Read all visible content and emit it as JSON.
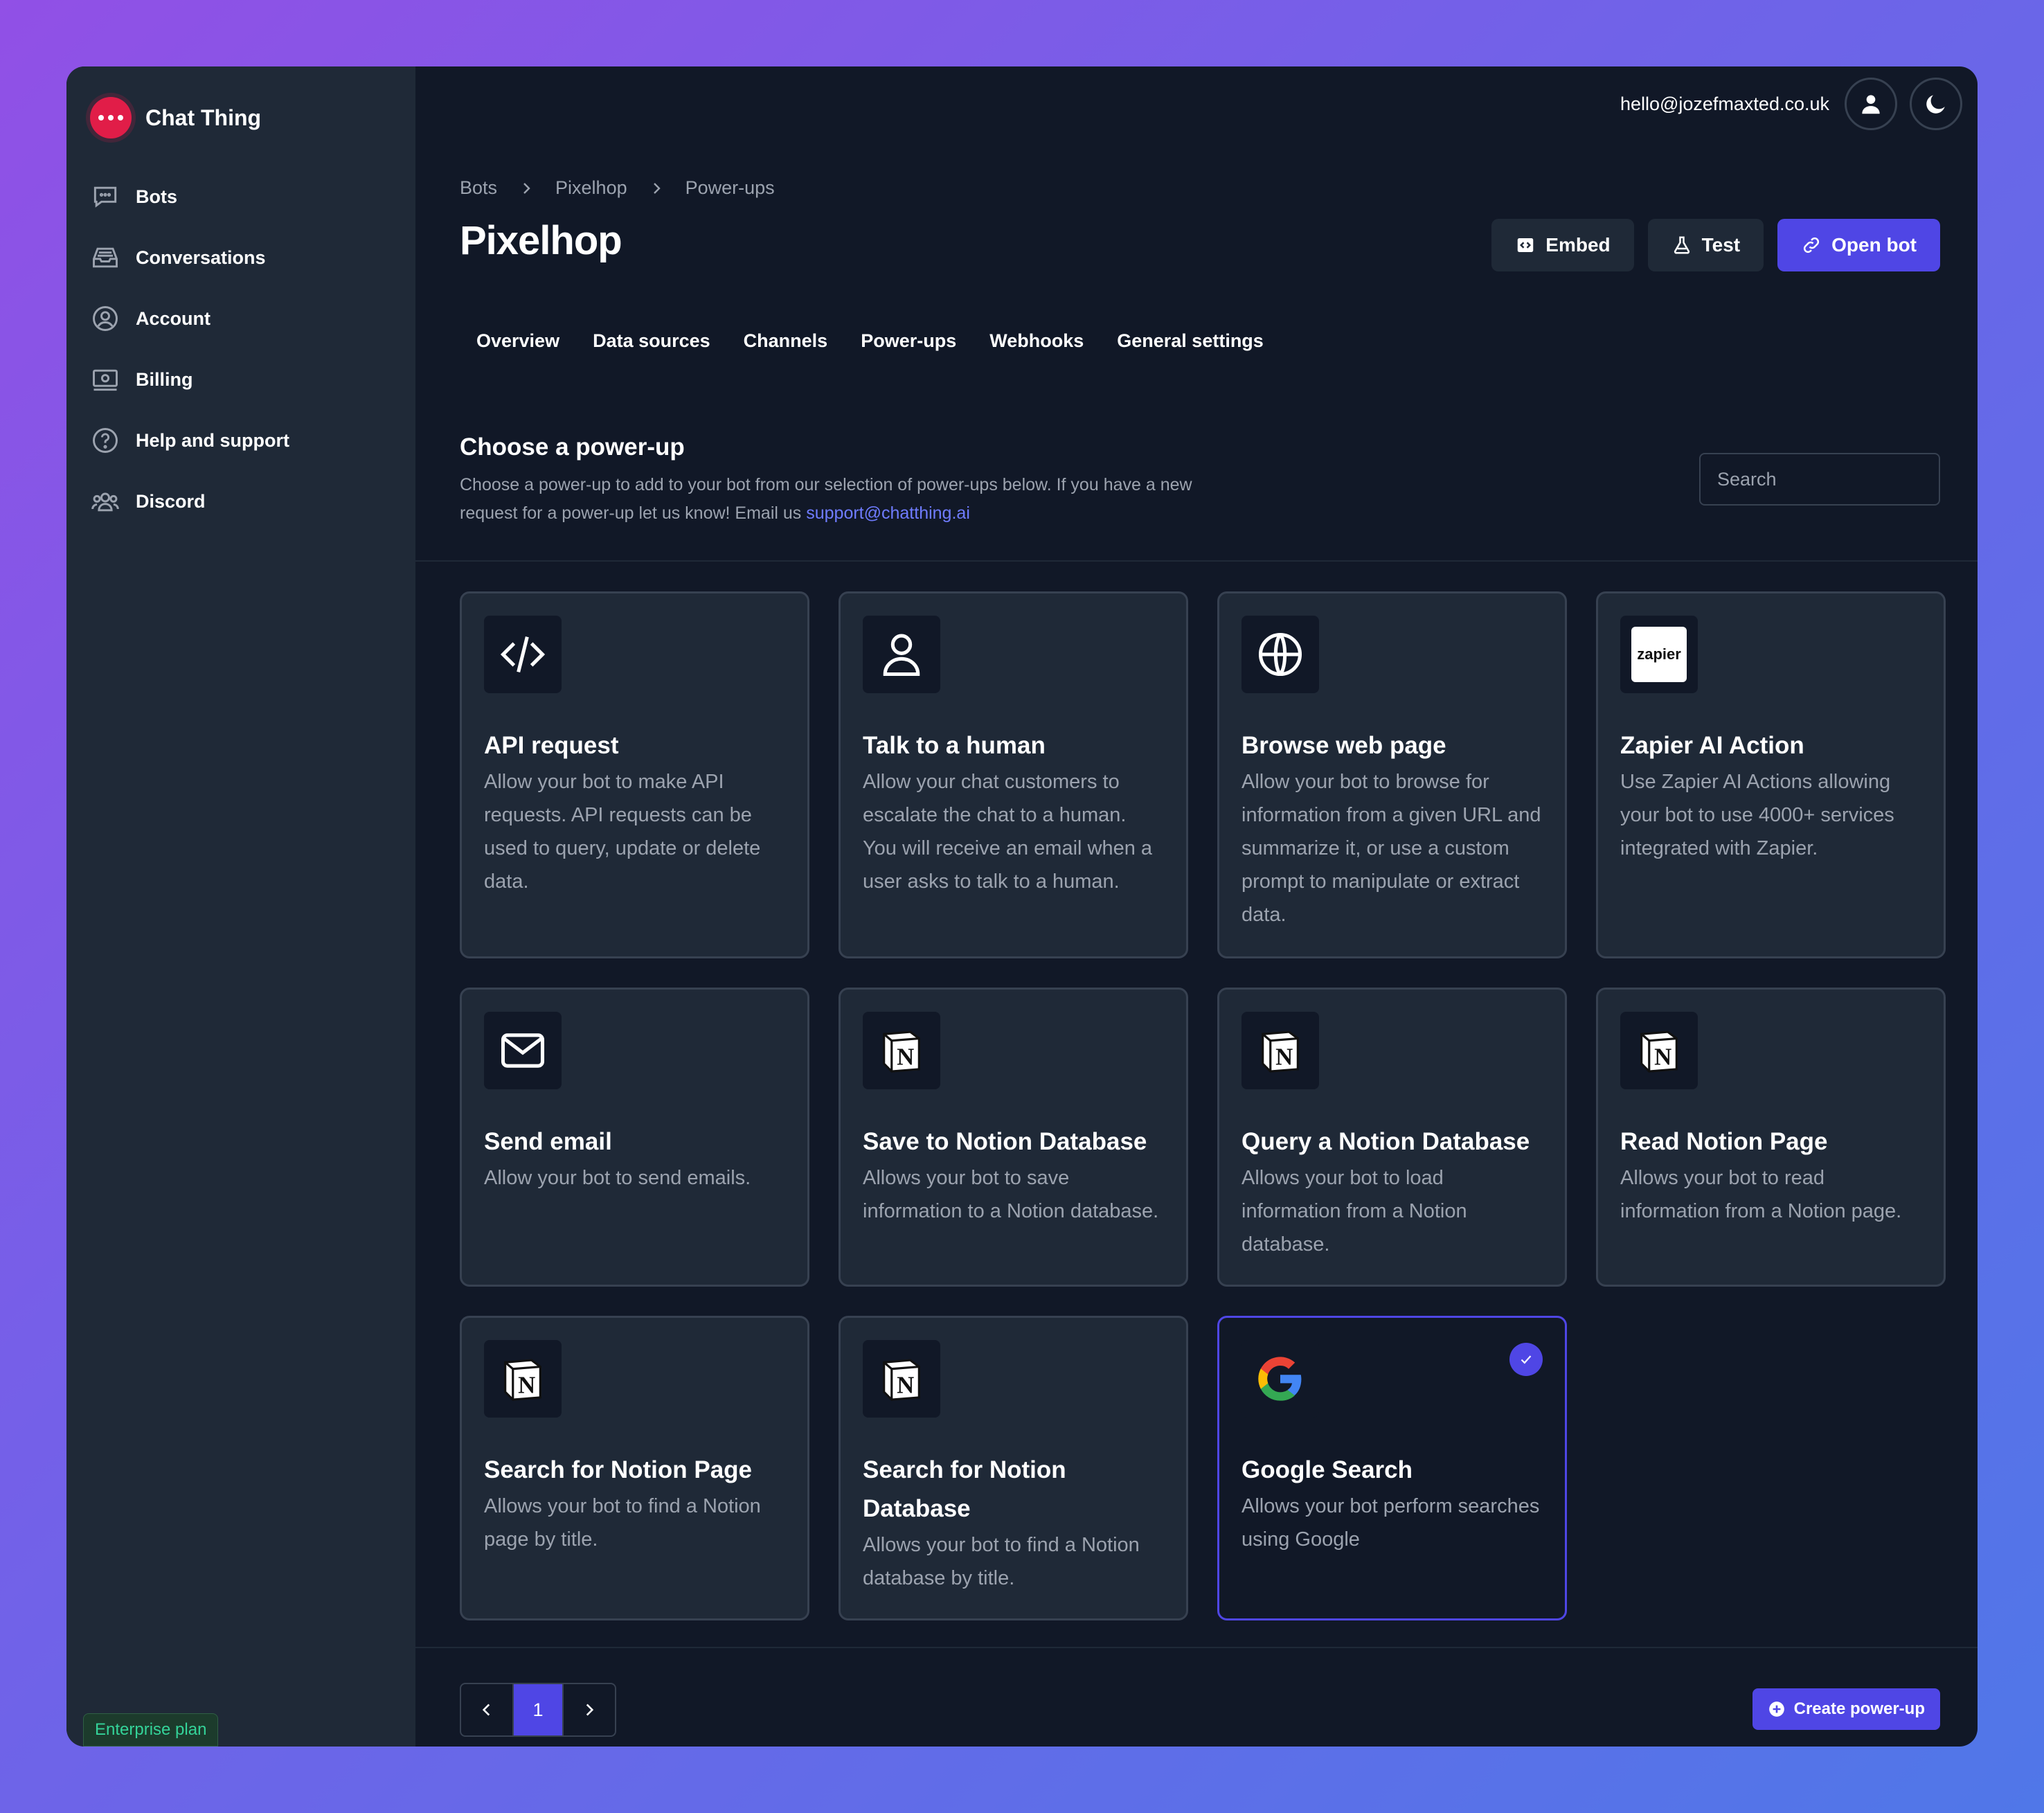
{
  "app": {
    "name": "Chat Thing",
    "plan": "Enterprise plan"
  },
  "sidebar": {
    "items": [
      {
        "label": "Bots",
        "icon": "chat-bubble-icon"
      },
      {
        "label": "Conversations",
        "icon": "inbox-icon"
      },
      {
        "label": "Account",
        "icon": "user-circle-icon"
      },
      {
        "label": "Billing",
        "icon": "banknote-icon"
      },
      {
        "label": "Help and support",
        "icon": "question-icon"
      },
      {
        "label": "Discord",
        "icon": "users-icon"
      }
    ]
  },
  "header": {
    "email": "hello@jozefmaxted.co.uk"
  },
  "breadcrumb": [
    "Bots",
    "Pixelhop",
    "Power-ups"
  ],
  "page": {
    "title": "Pixelhop"
  },
  "actions": {
    "embed": "Embed",
    "test": "Test",
    "open": "Open bot"
  },
  "tabs": [
    "Overview",
    "Data sources",
    "Channels",
    "Power-ups",
    "Webhooks",
    "General settings"
  ],
  "section": {
    "title": "Choose a power-up",
    "description": "Choose a power-up to add to your bot from our selection of power-ups below. If you have a new request for a power-up let us know! Email us ",
    "email_link": "support@chatthing.ai",
    "search_placeholder": "Search"
  },
  "powerups": [
    {
      "title": "API request",
      "description": "Allow your bot to make API requests. API requests can be used to query, update or delete data.",
      "icon": "code-icon",
      "selected": false
    },
    {
      "title": "Talk to a human",
      "description": "Allow your chat customers to escalate the chat to a human. You will receive an email when a user asks to talk to a human.",
      "icon": "person-icon",
      "selected": false
    },
    {
      "title": "Browse web page",
      "description": "Allow your bot to browse for information from a given URL and summarize it, or use a custom prompt to manipulate or extract data.",
      "icon": "globe-icon",
      "selected": false
    },
    {
      "title": "Zapier AI Action",
      "description": "Use Zapier AI Actions allowing your bot to use 4000+ services integrated with Zapier.",
      "icon": "zapier-icon",
      "icon_text": "zapier",
      "selected": false
    },
    {
      "title": "Send email",
      "description": "Allow your bot to send emails.",
      "icon": "envelope-icon",
      "selected": false
    },
    {
      "title": "Save to Notion Database",
      "description": "Allows your bot to save information to a Notion database.",
      "icon": "notion-icon",
      "selected": false
    },
    {
      "title": "Query a Notion Database",
      "description": "Allows your bot to load information from a Notion database.",
      "icon": "notion-icon",
      "selected": false
    },
    {
      "title": "Read Notion Page",
      "description": "Allows your bot to read information from a Notion page.",
      "icon": "notion-icon",
      "selected": false
    },
    {
      "title": "Search for Notion Page",
      "description": "Allows your bot to find a Notion page by title.",
      "icon": "notion-icon",
      "selected": false
    },
    {
      "title": "Search for Notion Database",
      "description": "Allows your bot to find a Notion database by title.",
      "icon": "notion-icon",
      "selected": false
    },
    {
      "title": "Google Search",
      "description": "Allows your bot perform searches using Google",
      "icon": "google-icon",
      "selected": true
    }
  ],
  "pagination": {
    "current": "1"
  },
  "create_button": "Create power-up",
  "colors": {
    "accent": "#4f46e5",
    "background": "#111827",
    "sidebar": "#1f2937",
    "brand": "#e11d48"
  }
}
